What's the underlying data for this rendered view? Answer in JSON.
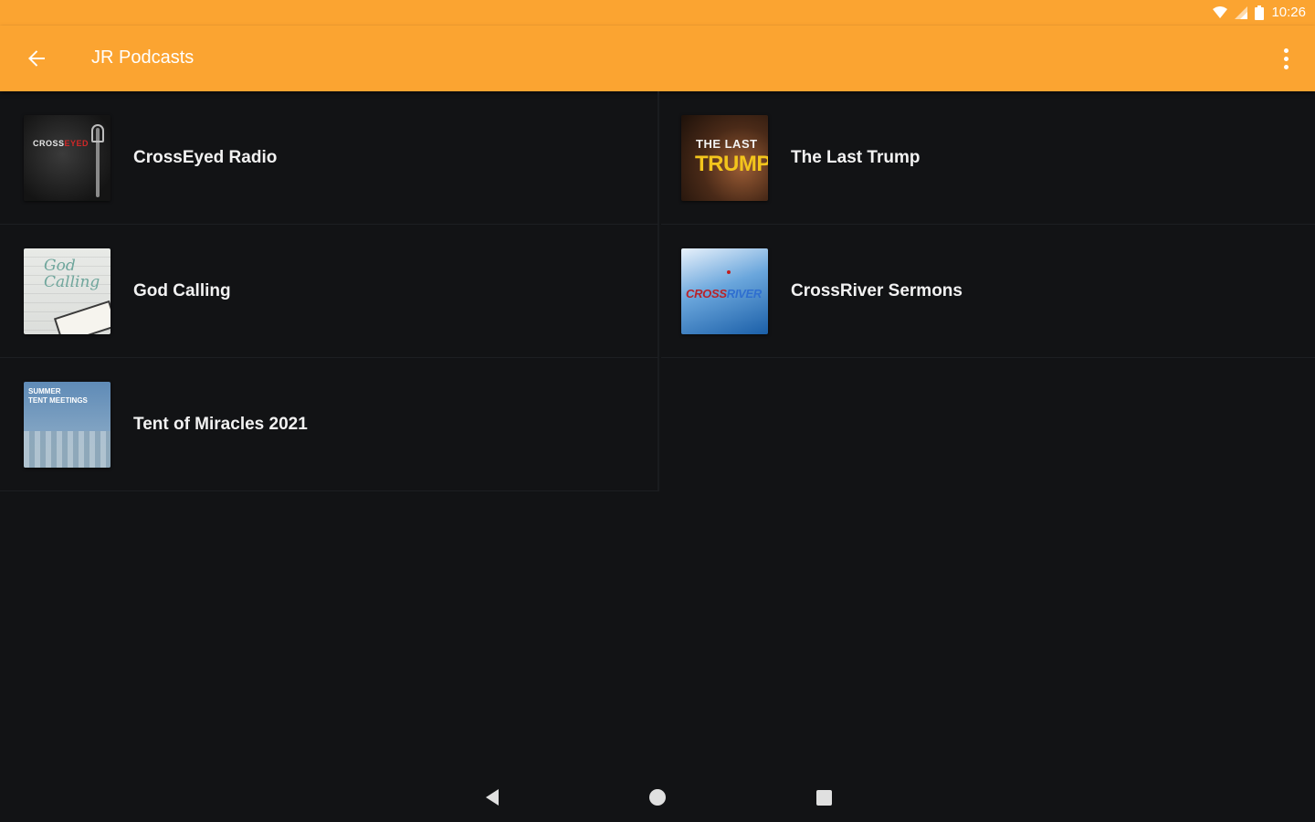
{
  "status_bar": {
    "time": "10:26",
    "wifi_icon": "wifi-icon",
    "signal_icon": "signal-icon",
    "battery_icon": "battery-icon"
  },
  "toolbar": {
    "title": "JR Podcasts",
    "back_icon": "arrow-back-icon",
    "menu_icon": "more-vert-icon",
    "color": "#fba431"
  },
  "podcasts": [
    {
      "title": "CrossEyed Radio",
      "artwork": "crosseyed-radio-artwork",
      "art_text": [
        "CROSS",
        "EYED"
      ]
    },
    {
      "title": "The Last Trump",
      "artwork": "the-last-trump-artwork",
      "art_text": [
        "THE LAST",
        "TRUMP"
      ]
    },
    {
      "title": "God Calling",
      "artwork": "god-calling-artwork",
      "art_text": [
        "God",
        "Calling"
      ]
    },
    {
      "title": "CrossRiver Sermons",
      "artwork": "crossriver-sermons-artwork",
      "art_text": [
        "CROSS",
        "RIVER"
      ]
    },
    {
      "title": "Tent of Miracles 2021",
      "artwork": "tent-of-miracles-artwork",
      "art_text": [
        "SUMMER",
        "TENT MEETINGS"
      ]
    }
  ],
  "nav_bar": {
    "back_icon": "nav-back-icon",
    "home_icon": "nav-home-icon",
    "recents_icon": "nav-recents-icon"
  },
  "colors": {
    "background": "#121315",
    "accent": "#fba431",
    "text": "#f2f2f2"
  }
}
